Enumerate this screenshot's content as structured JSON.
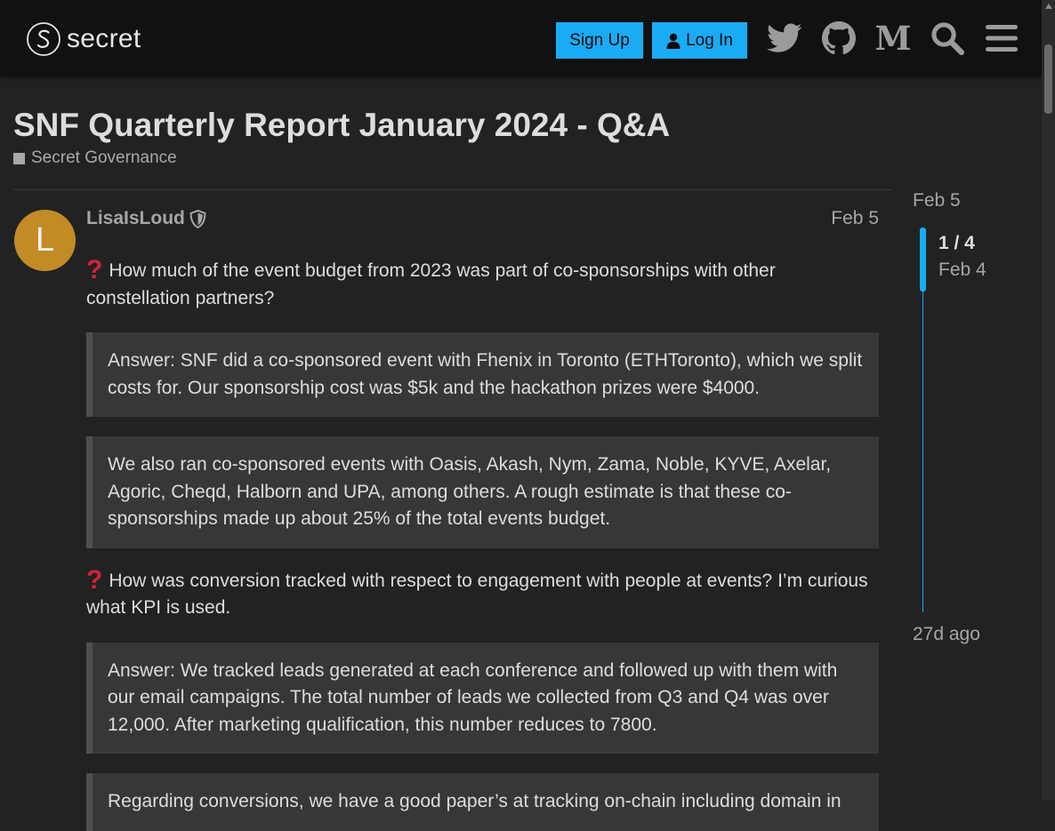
{
  "header": {
    "logo_text": "secret",
    "signup_label": "Sign Up",
    "login_label": "Log In",
    "icons": [
      "twitter-icon",
      "github-icon",
      "medium-icon",
      "search-icon",
      "hamburger-menu-icon"
    ],
    "medium_letter": "M"
  },
  "topic": {
    "title": "SNF Quarterly Report January 2024 - Q&A",
    "category": "Secret Governance"
  },
  "post": {
    "avatar_letter": "L",
    "username": "LisaIsLoud",
    "date": "Feb 5",
    "question_1": "How much of the event budget from 2023 was part of co-sponsorships with other constellation partners?",
    "answer_1a": "Answer: SNF did a co-sponsored event with Fhenix in Toronto (ETHToronto), which we split costs for. Our sponsorship cost was $5k and the hackathon prizes were $4000.",
    "answer_1b": "We also ran co-sponsored events with Oasis, Akash, Nym, Zama, Noble, KYVE, Axelar, Agoric, Cheqd, Halborn and UPA, among others. A rough estimate is that these co-sponsorships made up about 25% of the total events budget.",
    "question_2": "How was conversion tracked with respect to engagement with people at events? I’m curious what KPI is used.",
    "answer_2a": "Answer: We tracked leads generated at each conference and followed up with them with our email campaigns. The total number of leads we collected from Q3 and Q4 was over 12,000. After marketing qualification, this number reduces to 7800.",
    "answer_2b": "Regarding conversions, we have a good paper’s at tracking on-chain including domain in"
  },
  "timeline": {
    "top_date": "Feb 5",
    "count": "1 / 4",
    "current_date": "Feb 4",
    "bottom_label": "27d ago"
  },
  "colors": {
    "accent": "#1aabf5",
    "header_bg": "#111111",
    "page_bg": "#222222",
    "quote_bg": "#373737",
    "avatar": "#c28b25",
    "question_icon": "#d0243c"
  }
}
